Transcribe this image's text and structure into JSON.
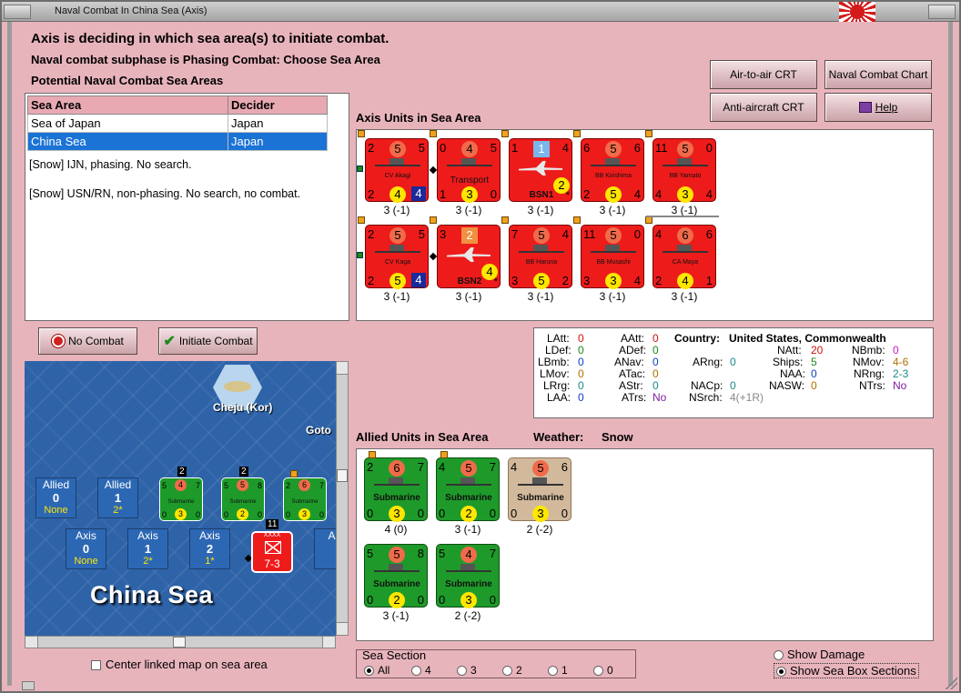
{
  "window": {
    "title": "Naval Combat In China Sea (Axis)"
  },
  "header": {
    "line1": "Axis is deciding in which sea area(s) to initiate combat.",
    "line2": "Naval combat subphase is Phasing Combat: Choose Sea Area",
    "line3": "Potential Naval Combat Sea Areas"
  },
  "buttons": {
    "air_to_air": "Air-to-air CRT",
    "naval_chart": "Naval Combat Chart",
    "anti_aircraft": "Anti-aircraft CRT",
    "help": "Help",
    "no_combat": "No Combat",
    "initiate_combat": "Initiate Combat"
  },
  "sea_table": {
    "headers": [
      "Sea Area",
      "Decider"
    ],
    "rows": [
      [
        "Sea of Japan",
        "Japan"
      ],
      [
        "China Sea",
        "Japan"
      ]
    ],
    "note1": "[Snow] IJN, phasing.  No search.",
    "note2": "[Snow] USN/RN, non-phasing.  No search, no combat."
  },
  "axis_units": {
    "label": "Axis Units in Sea Area",
    "counters": [
      {
        "tl": "2",
        "tc": "5",
        "tr": "5",
        "bl": "2",
        "bc": "4",
        "br": "4",
        "name": "CV Akagi",
        "stat": "3 (-1)"
      },
      {
        "tl": "0",
        "tc": "4",
        "tr": "5",
        "bl": "1",
        "bc": "3",
        "br": "0",
        "name": "Transport",
        "stat": "3 (-1)"
      },
      {
        "tl": "1",
        "tc": "1",
        "tr": "4",
        "bc": "2",
        "name": "BSN1",
        "star": "*",
        "stat": "3 (-1)"
      },
      {
        "tl": "6",
        "tc": "5",
        "tr": "6",
        "bl": "2",
        "bc": "5",
        "br": "4",
        "name": "BB Kirishima",
        "stat": "3 (-1)"
      },
      {
        "tl": "11",
        "tc": "5",
        "tr": "0",
        "bl": "4",
        "bc": "3",
        "br": "4",
        "name": "BB Yamato",
        "stat": "3 (-1)"
      },
      {
        "tl": "2",
        "tc": "5",
        "tr": "5",
        "bl": "2",
        "bc": "5",
        "br": "4",
        "name": "CV Kaga",
        "stat": "3 (-1)"
      },
      {
        "tl": "3",
        "tc": "2",
        "tr": "",
        "bc": "4",
        "name": "BSN2",
        "star": "*",
        "stat": "3 (-1)"
      },
      {
        "tl": "7",
        "tc": "5",
        "tr": "4",
        "bl": "3",
        "bc": "5",
        "br": "2",
        "name": "BB Haruna",
        "stat": "3 (-1)"
      },
      {
        "tl": "11",
        "tc": "5",
        "tr": "0",
        "bl": "3",
        "bc": "3",
        "br": "4",
        "name": "BB Musashi",
        "stat": "3 (-1)"
      },
      {
        "tl": "4",
        "tc": "6",
        "tr": "6",
        "bl": "2",
        "bc": "4",
        "br": "1",
        "name": "CA Maya",
        "stat": "3 (-1)"
      }
    ]
  },
  "info": {
    "latt": "LAtt:",
    "latt_v": "0",
    "ldef": "LDef:",
    "ldef_v": "0",
    "lbmb": "LBmb:",
    "lbmb_v": "0",
    "lmov": "LMov:",
    "lmov_v": "0",
    "lrrg": "LRrg:",
    "lrrg_v": "0",
    "laa": "LAA:",
    "laa_v": "0",
    "aatt": "AAtt:",
    "aatt_v": "0",
    "adef": "ADef:",
    "adef_v": "0",
    "anav": "ANav:",
    "anav_v": "0",
    "atac": "ATac:",
    "atac_v": "0",
    "astr": "AStr:",
    "astr_v": "0",
    "atrs": "ATrs:",
    "atrs_v": "No",
    "country_lbl": "Country:",
    "country": "United States, Commonwealth",
    "arng": "ARng:",
    "arng_v": "0",
    "nacp": "NACp:",
    "nacp_v": "0",
    "natt": "NAtt:",
    "natt_v": "20",
    "ships": "Ships:",
    "ships_v": "5",
    "naa": "NAA:",
    "naa_v": "0",
    "nasw": "NASW:",
    "nasw_v": "0",
    "nsrch": "NSrch:",
    "nsrch_v": "4(+1R)",
    "nbmb": "NBmb:",
    "nbmb_v": "0",
    "nmov": "NMov:",
    "nmov_v": "4-6",
    "nrng": "NRng:",
    "nrng_v": "2-3",
    "ntrs": "NTrs:",
    "ntrs_v": "No"
  },
  "allied_units": {
    "label": "Allied Units in Sea Area",
    "weather_lbl": "Weather:",
    "weather": "Snow",
    "counters": [
      {
        "tl": "2",
        "tc": "6",
        "tr": "7",
        "bl": "0",
        "bc": "3",
        "br": "0",
        "name": "Submarine",
        "stat": "4 (0)",
        "color": "green"
      },
      {
        "tl": "4",
        "tc": "5",
        "tr": "7",
        "bl": "0",
        "bc": "2",
        "br": "0",
        "name": "Submarine",
        "stat": "3 (-1)",
        "color": "green"
      },
      {
        "tl": "4",
        "tc": "5",
        "tr": "6",
        "bl": "0",
        "bc": "3",
        "br": "0",
        "name": "Submarine",
        "stat": "2 (-2)",
        "color": "tan"
      },
      {
        "tl": "5",
        "tc": "5",
        "tr": "8",
        "bl": "0",
        "bc": "2",
        "br": "0",
        "name": "Submarine",
        "stat": "3 (-1)",
        "color": "green"
      },
      {
        "tl": "5",
        "tc": "4",
        "tr": "7",
        "bl": "0",
        "bc": "3",
        "br": "0",
        "name": "Submarine",
        "stat": "2 (-2)",
        "color": "green"
      }
    ]
  },
  "map": {
    "island": "Cheju (Kor)",
    "goto": "Goto",
    "sea_name": "China Sea",
    "allied_boxes": [
      {
        "t": "Allied",
        "n": "0",
        "s": "None"
      },
      {
        "t": "Allied",
        "n": "1",
        "s": "2*"
      }
    ],
    "axis_boxes": [
      {
        "t": "Axis",
        "n": "0",
        "s": "None"
      },
      {
        "t": "Axis",
        "n": "1",
        "s": "2*"
      },
      {
        "t": "Axis",
        "n": "2",
        "s": "1*"
      },
      {
        "t": "Ax",
        "n": "",
        "s": ""
      }
    ],
    "mini_subs": [
      {
        "stack": "2",
        "tl": "5",
        "tc": "4",
        "tr": "7",
        "bl": "0",
        "bc": "3",
        "br": "0",
        "name": "Submarine"
      },
      {
        "stack": "2",
        "tl": "5",
        "tc": "5",
        "tr": "8",
        "bl": "0",
        "bc": "2",
        "br": "0",
        "name": "Submarine"
      },
      {
        "stack": "",
        "tl": "2",
        "tc": "6",
        "tr": "7",
        "bl": "0",
        "bc": "3",
        "br": "0",
        "name": "Submarine"
      }
    ],
    "army": {
      "stack": "11",
      "size": "XXXX",
      "value": "7-3"
    },
    "center_linked": "Center linked map on sea area"
  },
  "sea_section": {
    "label": "Sea Section",
    "options": [
      "All",
      "4",
      "3",
      "2",
      "1",
      "0"
    ]
  },
  "toggles": {
    "show_damage": "Show Damage",
    "show_sections": "Show Sea Box Sections"
  }
}
